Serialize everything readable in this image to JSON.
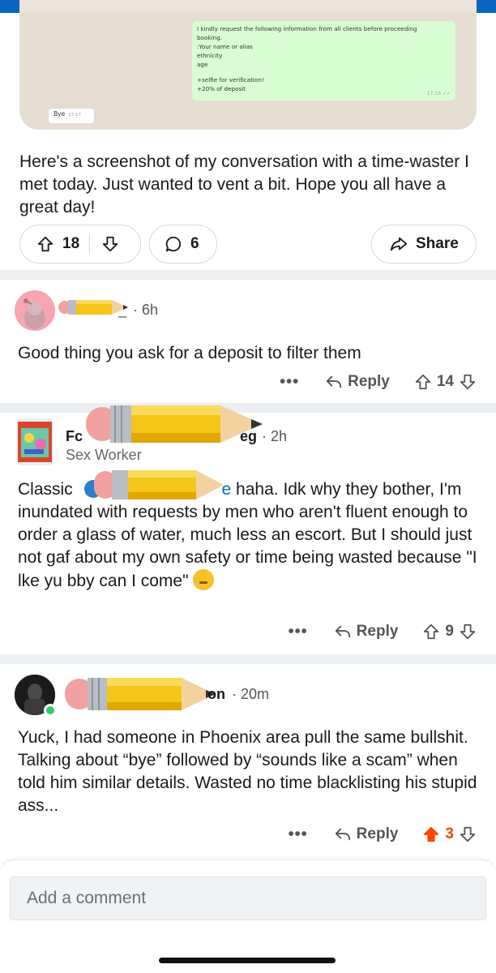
{
  "screenshot": {
    "green_lines": [
      "I kindly request the following information from all clients before proceeding",
      "booking.",
      ":Your name or alias",
      "ethnicity",
      "age",
      "",
      "+selfie for verification!",
      "+20% of deposit"
    ],
    "green_time": "17:16 ✓✓",
    "white_text": "Bye",
    "white_time": "17:17"
  },
  "post": {
    "body": "Here's a screenshot of my conversation with a time-waster I met today. Just wanted to vent a bit. Hope you all have a great day!",
    "upvotes": "18",
    "comments": "6",
    "share_label": "Share"
  },
  "comments": [
    {
      "user_suffix": "_",
      "time": "· 6h",
      "body": "Good thing you ask for a deposit to filter them",
      "more": "•••",
      "reply_label": "Reply",
      "votes": "14"
    },
    {
      "user_prefix": "Fc",
      "user_suffix": "eg",
      "time": "· 2h",
      "flair": "Sex Worker",
      "body_start": "Classic",
      "body_mention_end": "e",
      "body_rest": " haha. Idk why they bother, I'm inundated with requests by men who aren't fluent enough to order a glass of water, much less an escort. But I should just not gaf about my own safety  or time being wasted because \"I lke yu bby can I come\"",
      "more": "•••",
      "reply_label": "Reply",
      "votes": "9"
    },
    {
      "user_suffix": "on",
      "time": "· 20m",
      "body": "Yuck, I had someone in Phoenix area pull the same bullshit. Talking about “bye” followed by “sounds like a scam” when told him similar details. Wasted no time blacklisting his stupid ass...",
      "more": "•••",
      "reply_label": "Reply",
      "votes": "3"
    }
  ],
  "composer": {
    "placeholder": "Add a comment"
  },
  "icons": [
    "upvote-icon",
    "downvote-icon",
    "comment-icon",
    "share-icon",
    "reply-icon",
    "more-icon",
    "pencil-sticker-icon",
    "emoji-icon"
  ],
  "colors": {
    "accent_blue": "#0a66c2",
    "upvoted_orange": "#ff4500",
    "divider": "#eceff1",
    "whatsapp_green": "#d8fdd2"
  }
}
